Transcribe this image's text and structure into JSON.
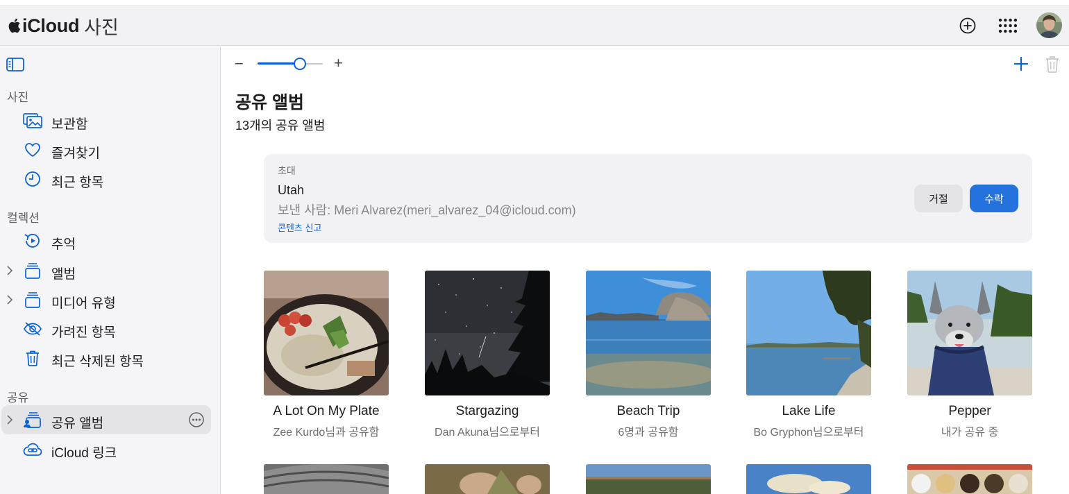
{
  "header": {
    "brand": "iCloud",
    "app_name": "사진",
    "icons": [
      "apple-logo",
      "add-circle-icon",
      "app-grid-icon"
    ]
  },
  "sidebar": {
    "sections": [
      {
        "label": "사진"
      },
      {
        "label": "컬렉션"
      },
      {
        "label": "공유"
      }
    ],
    "items": [
      {
        "label": "보관함",
        "icon": "library-icon"
      },
      {
        "label": "즐겨찾기",
        "icon": "heart-icon"
      },
      {
        "label": "최근 항목",
        "icon": "clock-icon"
      },
      {
        "label": "추억",
        "icon": "memories-icon"
      },
      {
        "label": "앨범",
        "icon": "album-stack-icon"
      },
      {
        "label": "미디어 유형",
        "icon": "album-stack-icon"
      },
      {
        "label": "가려진 항목",
        "icon": "eye-slash-icon"
      },
      {
        "label": "최근 삭제된 항목",
        "icon": "trash-icon"
      },
      {
        "label": "공유 앨범",
        "icon": "shared-album-icon"
      },
      {
        "label": "iCloud 링크",
        "icon": "link-cloud-icon"
      }
    ]
  },
  "toolbar": {
    "zoom_minus": "−",
    "zoom_plus": "+",
    "zoom_level": 0.65
  },
  "main": {
    "title": "공유 앨범",
    "subtitle": "13개의 공유 앨범"
  },
  "invite": {
    "tag": "초대",
    "album_name": "Utah",
    "from": "보낸 사람: Meri Alvarez(meri_alvarez_04@icloud.com)",
    "report": "콘텐츠 신고",
    "decline": "거절",
    "accept": "수락"
  },
  "albums": [
    {
      "title": "A Lot On My Plate",
      "sub": "Zee Kurdo님과 공유함"
    },
    {
      "title": "Stargazing",
      "sub": "Dan Akuna님으로부터"
    },
    {
      "title": "Beach Trip",
      "sub": "6명과 공유함"
    },
    {
      "title": "Lake Life",
      "sub": "Bo Gryphon님으로부터"
    },
    {
      "title": "Pepper",
      "sub": "내가 공유 중"
    }
  ],
  "colors": {
    "accent": "#0a62d8",
    "accept_button": "#2472de",
    "sidebar_bg": "#f5f5f7",
    "active_row": "#e4e4e7"
  }
}
